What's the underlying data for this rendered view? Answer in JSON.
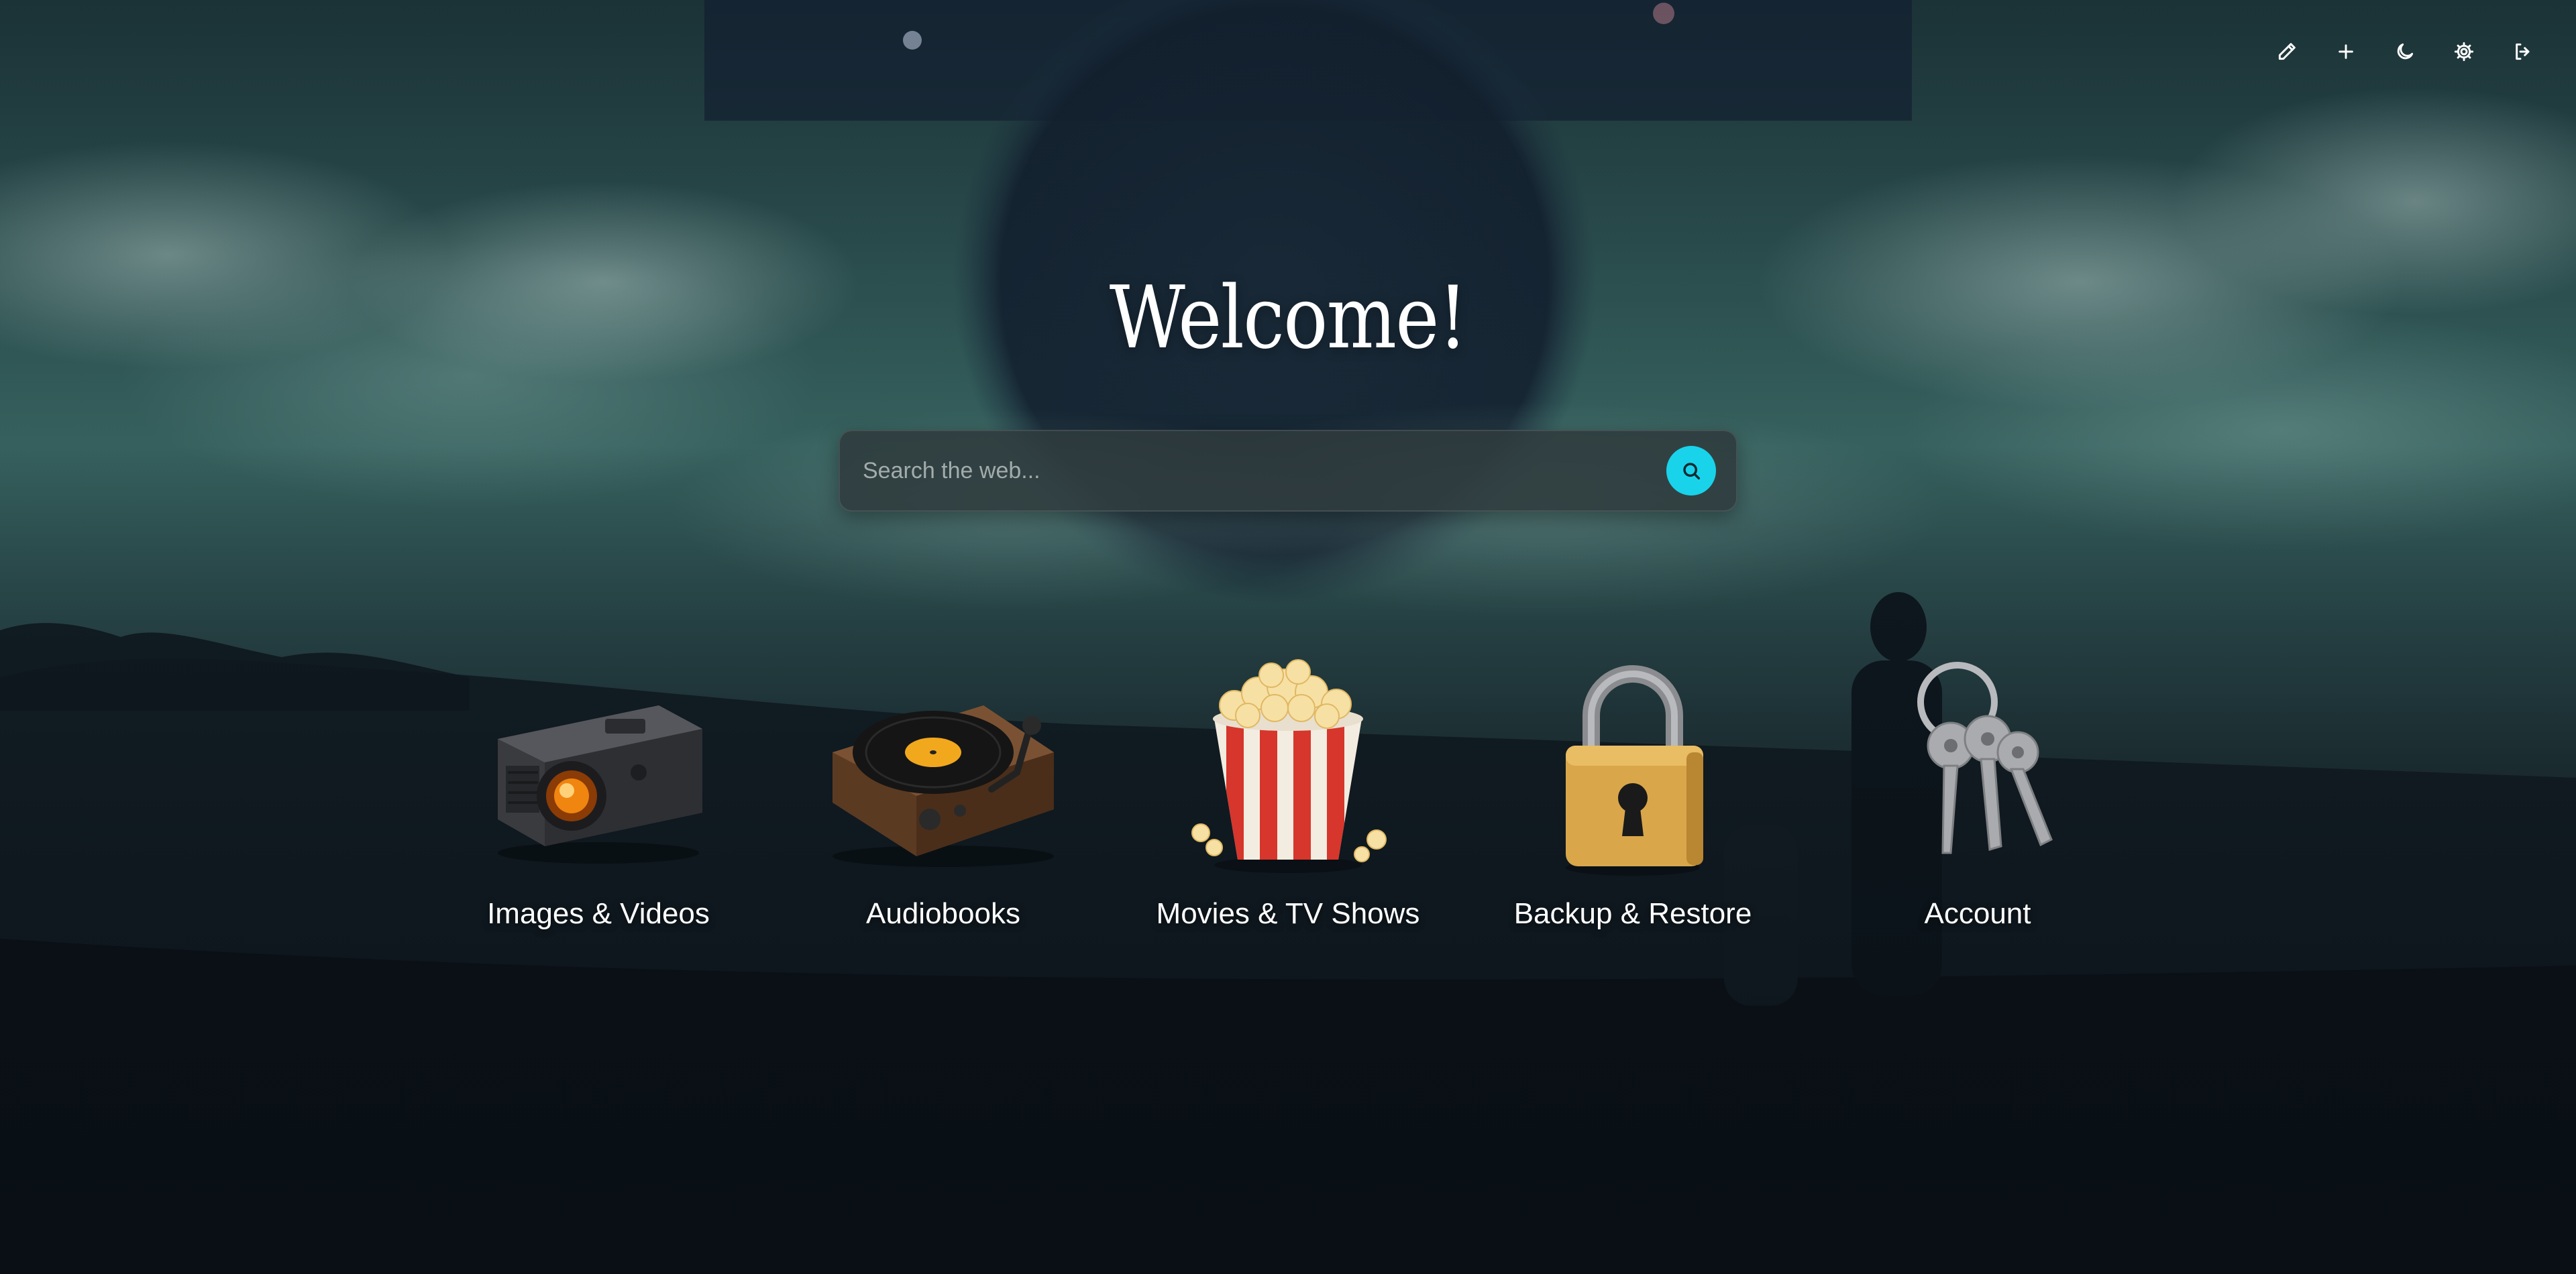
{
  "toolbar": {
    "icons": [
      "pencil-icon",
      "plus-icon",
      "moon-icon",
      "gear-icon",
      "logout-icon"
    ]
  },
  "welcome": {
    "title": "Welcome!"
  },
  "search": {
    "placeholder": "Search the web...",
    "value": "",
    "icon": "search-icon",
    "accent": "#19d3ea"
  },
  "tiles": [
    {
      "label": "Images & Videos",
      "icon": "projector-icon"
    },
    {
      "label": "Audiobooks",
      "icon": "turntable-icon"
    },
    {
      "label": "Movies & TV Shows",
      "icon": "popcorn-icon"
    },
    {
      "label": "Backup & Restore",
      "icon": "padlock-icon"
    },
    {
      "label": "Account",
      "icon": "keys-icon"
    }
  ]
}
